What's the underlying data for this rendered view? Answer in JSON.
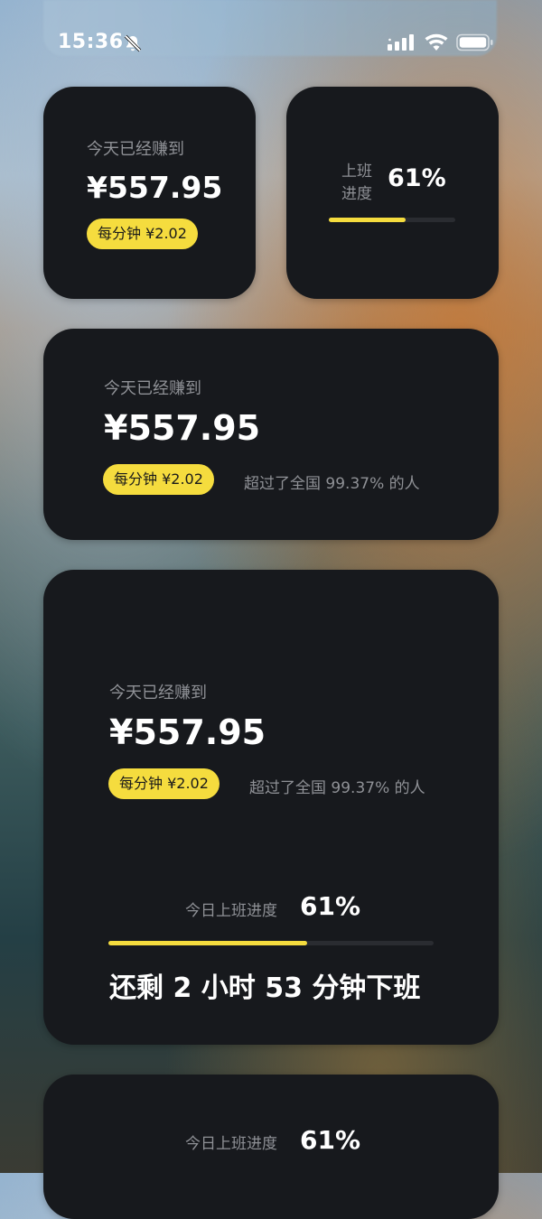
{
  "status_bar": {
    "time": "15:36",
    "icons": [
      "bell-slash-icon",
      "cellular-signal-icon",
      "wifi-icon",
      "battery-icon"
    ]
  },
  "colors": {
    "accent": "#f5dc3e",
    "card": "#17191d",
    "muted": "#8f9196"
  },
  "widget_small_earnings": {
    "label": "今天已经赚到",
    "amount": "¥557.95",
    "per_minute": "每分钟 ¥2.02"
  },
  "widget_small_progress": {
    "label_line1": "上班",
    "label_line2": "进度",
    "percent": "61%",
    "progress": 0.61
  },
  "widget_medium": {
    "label": "今天已经赚到",
    "amount": "¥557.95",
    "per_minute": "每分钟 ¥2.02",
    "rank_text": "超过了全国 99.37% 的人"
  },
  "widget_large": {
    "label": "今天已经赚到",
    "amount": "¥557.95",
    "per_minute": "每分钟 ¥2.02",
    "rank_text": "超过了全国 99.37% 的人",
    "progress_label": "今日上班进度",
    "percent": "61%",
    "progress": 0.61,
    "remaining": "还剩 2 小时 53 分钟下班"
  },
  "widget_bottom": {
    "progress_label": "今日上班进度",
    "percent": "61%"
  }
}
